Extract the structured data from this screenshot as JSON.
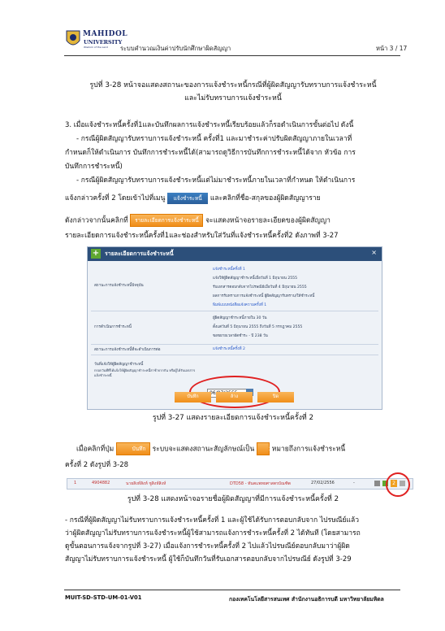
{
  "header": {
    "org_name": "MAHIDOL",
    "org_sub": "UNIVERSITY",
    "org_tagline": "Wisdom of the Land",
    "doc_title": "ระบบคำนวณเงินค่าปรับนักศึกษาผิดสัญญา",
    "page": "หน้า 3 / 17"
  },
  "caption_top": [
    "รูปที่ 3-28 หน้าจอแสดงสถานะของการแจ้งชำระหนี้กรณีที่ผู้ผิดสัญญารับทราบการแจ้งชำระหนี้",
    "และไม่รับทราบการแจ้งชำระหนี้"
  ],
  "paragraphs": {
    "p1": "3. เมื่อแจ้งชำระหนี้ครั้งที่1และบันทึกผลการแจ้งชำระหนี้เรียบร้อยแล้วก็รอดำเนินการขั้นต่อไป ดังนี้",
    "p2a": "- กรณีผู้ผิดสัญญารับทราบการแจ้งชำระหนี้ ครั้งที่1 และมาชำระค่าปรับผิดสัญญาภายในเวลาที่",
    "p2b": "กำหนดก็ให้ดำเนินการ บันทึกการชำระหนี้ได้(สามารถดูวิธีการบันทึกการชำระหนี้ได้จาก หัวข้อ การ",
    "p2c": "บันทึกการชำระหนี้)",
    "p3a": "- กรณีผู้ผิดสัญญารับทราบการแจ้งชำระหนี้แต่ไม่มาชำระหนี้ภายในเวลาที่กำหนด ให้ดำเนินการ",
    "p3b_pre": "แจ้งกล่าวครั้งที่ 2 โดยเข้าไปที่เมนู",
    "p3b_post": "และคลิกที่ชื่อ-สกุลของผู้ผิดสัญญาราย",
    "p3c_pre": "ดังกล่าวจากนั้นคลิกที่",
    "p3c_post": "จะแสดงหน้าจอรายละเอียดของผู้ผิดสัญญา",
    "p3d": "รายละเอียดการแจ้งชำระหนี้ครั้งที่1และช่องสำหรับใส่วันที่แจ้งชำระหนี้ครั้งที่2 ดังภาพที่ 3-27",
    "menu_chip": "แจ้งชำระหนี้",
    "detail_chip": "รายละเอียดการแจ้งชำระหนี้"
  },
  "panel": {
    "title": "รายละเอียดการแจ้งชำระหนี้",
    "close": "×",
    "sec1_label": "สถานะการแจ้งชำระหนี้ปัจจุบัน",
    "sec1_lines": [
      "แจ้งชำระหนี้ครั้งที่ 1",
      "แจ้งให้ผู้ผิดสัญญาชำระหนี้เมื่อวันที่ 1 มิถุนายน 2555",
      "รับเอกสารตอบกลับจากไปรษณีย์เมื่อวันที่ 4 มิถุนายน 2555",
      "ผลการรับทราบการแจ้งชำระหนี้ ผู้ผิดสัญญารับทราบ/ให้ชำระหนี้",
      "พิมพ์แบบหนังสือแจ้งความครั้งที่ 1"
    ],
    "sec2_label": "การดำเนินการชำระหนี้",
    "sec2_lines": [
      "ผู้ผิดสัญญาชำระหนี้ภายใน 30 วัน",
      "ตั้งแต่วันที่ 5 มิถุนายน 2555 ถึงวันที่ 5 กรกฎาคม 2555",
      "ขอขยายเวลาผัดชำระ - ปี 238 วัน"
    ],
    "sec3_label": "สถานะการแจ้งชำระหนี้ที่จะดำเนินการต่อ",
    "sec3_value": "แจ้งชำระหนี้ครั้งที่ 2",
    "date_label": "วันที่แจ้งให้ผู้ผิดสัญญาชำระหนี้",
    "date_hint": "กรอกวันที่ที่ได้แจ้งให้ผู้ผิดสัญญาชำระหนี้ล่าช้าจากกัน หรือผู้ได้รับเอกสารแจ้งชำระหนี้",
    "date_value": "06/07/2555",
    "btn_save": "บันทึก",
    "btn_cancel": "ล้าง",
    "btn_close": "ปิด"
  },
  "caption_mid": "รูปที่ 3-27 แสดงรายละเอียดการแจ้งชำระหนี้ครั้งที่ 2",
  "para2": {
    "pre": "เมื่อคลิกที่ปุ่ม",
    "save_chip": "บันทึก",
    "mid": "ระบบจะแสดงสถานะสัญลักษณ์เป็น",
    "badge": "2",
    "post": "หมายถึงการแจ้งชำระหนี้",
    "line2": "ครั้งที่ 2 ดังรูปที่ 3-28"
  },
  "status_row": {
    "no": "1",
    "id": "4904882",
    "name": "นายสิงห์สิงห์ ชูสิงห์สิงห์",
    "code": "DTD58 - ทันตแพทยศาสตรบัณฑิต",
    "date": "27/02/2556",
    "dash": "-"
  },
  "caption_bottom": "รูปที่ 3-28 แสดงหน้าจอรายชื่อผู้ผิดสัญญาที่มีการแจ้งชำระหนี้ครั้งที่ 2",
  "para3": [
    "- กรณีที่ผู้ผิดสัญญาไม่รับทราบการแจ้งชำระหนี้ครั้งที่ 1 และผู้ใช้ได้รับการตอบกลับจาก ไปรษณีย์แล้ว",
    "ว่าผู้ผิดสัญญาไม่รับทราบการแจ้งชำระหนี้ผู้ใช้สามารถแจ้งการชำระหนี้ครั้งที่ 2 ได้ทันที (โดยสามารถ",
    "ดูขั้นตอนการแจ้งจากรูปที่ 3-27) เมื่อแจ้งการชำระหนี้ครั้งที่ 2 ไปแล้วไปรษณีย์ตอบกลับมาว่าผู้ผิด",
    "สัญญาไม่รับทราบการแจ้งชำระหนี้ ผู้ใช้ก็บันทึกวันที่รับเอกสารตอบกลับจากไปรษณีย์ ดังรูปที่ 3-29"
  ],
  "footer": {
    "left": "MUIT-SD-STD-UM-01-V01",
    "right": "กองเทคโนโลยีสารสนเทศ สำนักงานอธิการบดี มหาวิทยาลัยมหิดล"
  }
}
